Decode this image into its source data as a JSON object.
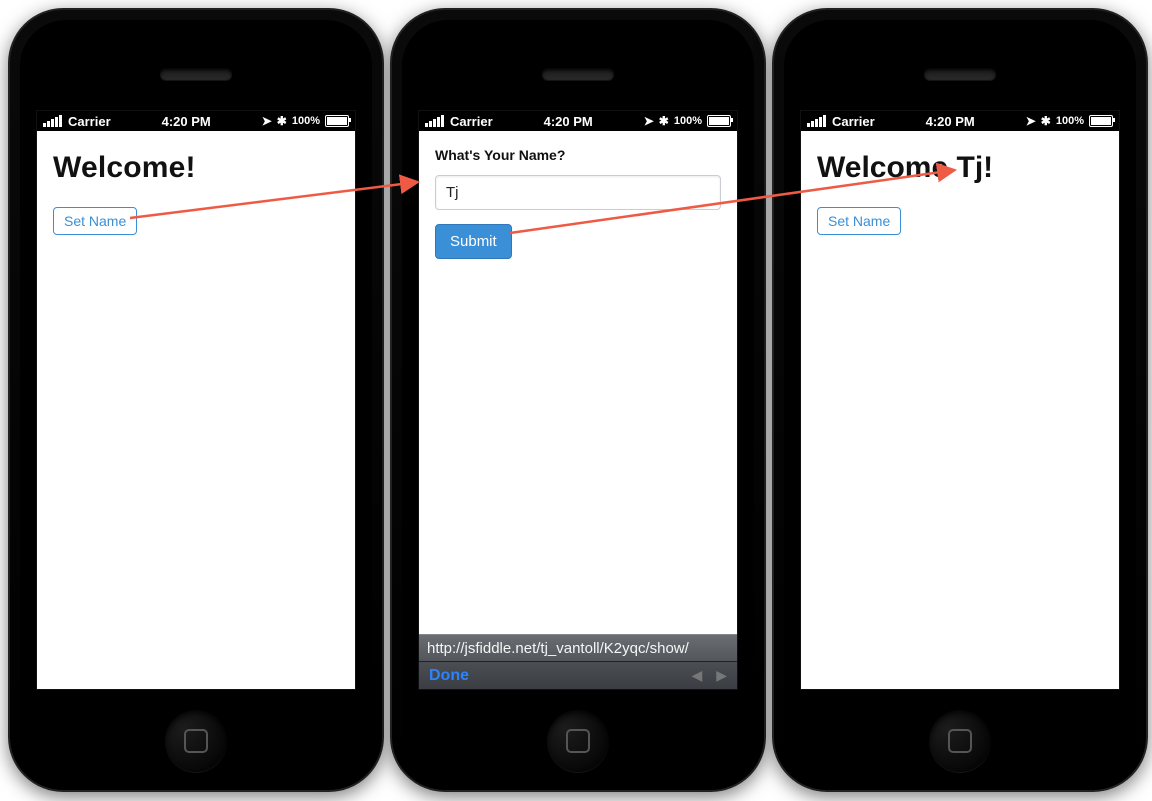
{
  "status": {
    "carrier": "Carrier",
    "time": "4:20 PM",
    "battery": "100%"
  },
  "screen1": {
    "title": "Welcome!",
    "set_name_label": "Set Name"
  },
  "screen2": {
    "prompt": "What's Your Name?",
    "input_value": "Tj",
    "submit_label": "Submit",
    "url": "http://jsfiddle.net/tj_vantoll/K2yqc/show/",
    "done_label": "Done"
  },
  "screen3": {
    "title": "Welcome Tj!",
    "set_name_label": "Set Name"
  },
  "arrows": {
    "color": "#ef5a45"
  }
}
